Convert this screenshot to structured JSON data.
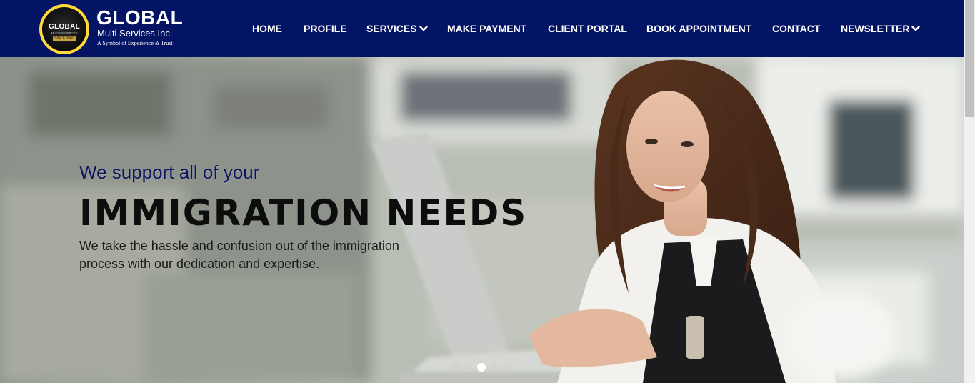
{
  "brand": {
    "name": "GLOBAL",
    "subtitle": "Multi Services Inc.",
    "tagline": "A Symbol of Experience & Trust",
    "badge_title": "GLOBAL",
    "badge_sub": "MULTI SERVICES",
    "badge_since": "SINCE 2009"
  },
  "nav": {
    "items": [
      {
        "label": "HOME"
      },
      {
        "label": "PROFILE"
      },
      {
        "label": "SERVICES",
        "dropdown": true
      },
      {
        "label": "MAKE PAYMENT"
      },
      {
        "label": "CLIENT PORTAL"
      },
      {
        "label": "BOOK APPOINTMENT"
      },
      {
        "label": "CONTACT"
      },
      {
        "label": "NEWSLETTER",
        "dropdown": true
      }
    ]
  },
  "hero": {
    "kicker": "We support all of your",
    "title": "IMMIGRATION NEEDS",
    "body": "We take the hassle and confusion out of the immigration process with our dedication and expertise.",
    "slide_count": 5,
    "active_slide": 3
  },
  "colors": {
    "header_bg": "#041464",
    "accent_gold": "#ffd83a",
    "kicker_text": "#0b1460"
  },
  "icons": {
    "dropdown": "chevron-down-icon"
  }
}
